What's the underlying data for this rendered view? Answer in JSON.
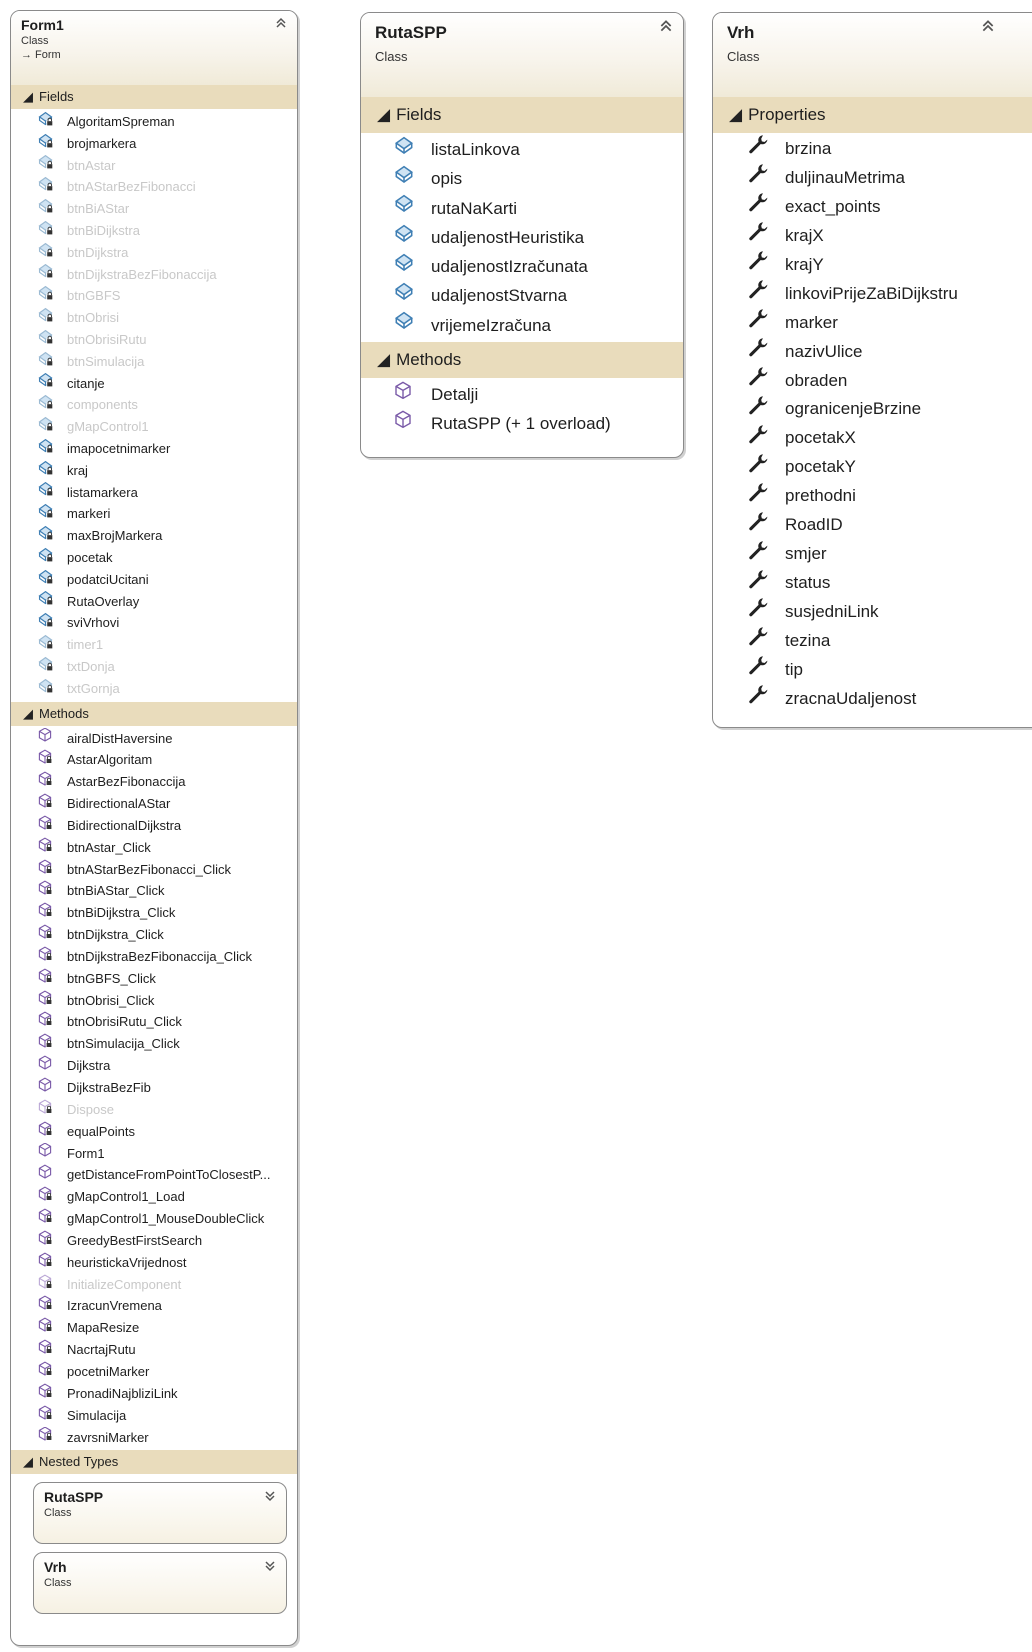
{
  "form1": {
    "title": "Form1",
    "stereotype": "Class",
    "base": "→ Form",
    "fields_label": "Fields",
    "fields": [
      {
        "name": "AlgoritamSpreman",
        "dim": false
      },
      {
        "name": "brojmarkera",
        "dim": false
      },
      {
        "name": "btnAstar",
        "dim": true
      },
      {
        "name": "btnAStarBezFibonacci",
        "dim": true
      },
      {
        "name": "btnBiAStar",
        "dim": true
      },
      {
        "name": "btnBiDijkstra",
        "dim": true
      },
      {
        "name": "btnDijkstra",
        "dim": true
      },
      {
        "name": "btnDijkstraBezFibonaccija",
        "dim": true
      },
      {
        "name": "btnGBFS",
        "dim": true
      },
      {
        "name": "btnObrisi",
        "dim": true
      },
      {
        "name": "btnObrisiRutu",
        "dim": true
      },
      {
        "name": "btnSimulacija",
        "dim": true
      },
      {
        "name": "citanje",
        "dim": false
      },
      {
        "name": "components",
        "dim": true
      },
      {
        "name": "gMapControl1",
        "dim": true
      },
      {
        "name": "imapocetnimarker",
        "dim": false
      },
      {
        "name": "kraj",
        "dim": false
      },
      {
        "name": "listamarkera",
        "dim": false
      },
      {
        "name": "markeri",
        "dim": false
      },
      {
        "name": "maxBrojMarkera",
        "dim": false
      },
      {
        "name": "pocetak",
        "dim": false
      },
      {
        "name": "podatciUcitani",
        "dim": false
      },
      {
        "name": "RutaOverlay",
        "dim": false
      },
      {
        "name": "sviVrhovi",
        "dim": false
      },
      {
        "name": "timer1",
        "dim": true
      },
      {
        "name": "txtDonja",
        "dim": true
      },
      {
        "name": "txtGornja",
        "dim": true
      }
    ],
    "methods_label": "Methods",
    "methods": [
      {
        "name": "airalDistHaversine",
        "dim": false,
        "public": true
      },
      {
        "name": "AstarAlgoritam",
        "dim": false,
        "public": false
      },
      {
        "name": "AstarBezFibonaccija",
        "dim": false,
        "public": false
      },
      {
        "name": "BidirectionalAStar",
        "dim": false,
        "public": false
      },
      {
        "name": "BidirectionalDijkstra",
        "dim": false,
        "public": false
      },
      {
        "name": "btnAstar_Click",
        "dim": false,
        "public": false
      },
      {
        "name": "btnAStarBezFibonacci_Click",
        "dim": false,
        "public": false
      },
      {
        "name": "btnBiAStar_Click",
        "dim": false,
        "public": false
      },
      {
        "name": "btnBiDijkstra_Click",
        "dim": false,
        "public": false
      },
      {
        "name": "btnDijkstra_Click",
        "dim": false,
        "public": false
      },
      {
        "name": "btnDijkstraBezFibonaccija_Click",
        "dim": false,
        "public": false
      },
      {
        "name": "btnGBFS_Click",
        "dim": false,
        "public": false
      },
      {
        "name": "btnObrisi_Click",
        "dim": false,
        "public": false
      },
      {
        "name": "btnObrisiRutu_Click",
        "dim": false,
        "public": false
      },
      {
        "name": "btnSimulacija_Click",
        "dim": false,
        "public": false
      },
      {
        "name": "Dijkstra",
        "dim": false,
        "public": true
      },
      {
        "name": "DijkstraBezFib",
        "dim": false,
        "public": true
      },
      {
        "name": "Dispose",
        "dim": true,
        "public": false
      },
      {
        "name": "equalPoints",
        "dim": false,
        "public": false
      },
      {
        "name": "Form1",
        "dim": false,
        "public": true
      },
      {
        "name": "getDistanceFromPointToClosestP...",
        "dim": false,
        "public": true
      },
      {
        "name": "gMapControl1_Load",
        "dim": false,
        "public": false
      },
      {
        "name": "gMapControl1_MouseDoubleClick",
        "dim": false,
        "public": false
      },
      {
        "name": "GreedyBestFirstSearch",
        "dim": false,
        "public": false
      },
      {
        "name": "heuristickaVrijednost",
        "dim": false,
        "public": false
      },
      {
        "name": "InitializeComponent",
        "dim": true,
        "public": false
      },
      {
        "name": "IzracunVremena",
        "dim": false,
        "public": false
      },
      {
        "name": "MapaResize",
        "dim": false,
        "public": false
      },
      {
        "name": "NacrtajRutu",
        "dim": false,
        "public": false
      },
      {
        "name": "pocetniMarker",
        "dim": false,
        "public": false
      },
      {
        "name": "PronadiNajbliziLink",
        "dim": false,
        "public": false
      },
      {
        "name": "Simulacija",
        "dim": false,
        "public": false
      },
      {
        "name": "zavrsniMarker",
        "dim": false,
        "public": false
      }
    ],
    "nested_label": "Nested Types",
    "nested": [
      {
        "title": "RutaSPP",
        "stereotype": "Class"
      },
      {
        "title": "Vrh",
        "stereotype": "Class"
      }
    ]
  },
  "rutaspp": {
    "title": "RutaSPP",
    "stereotype": "Class",
    "fields_label": "Fields",
    "fields": [
      "listaLinkova",
      "opis",
      "rutaNaKarti",
      "udaljenostHeuristika",
      "udaljenostIzračunata",
      "udaljenostStvarna",
      "vrijemeIzračuna"
    ],
    "methods_label": "Methods",
    "methods": [
      "Detalji",
      "RutaSPP (+ 1 overload)"
    ]
  },
  "vrh": {
    "title": "Vrh",
    "stereotype": "Class",
    "properties_label": "Properties",
    "properties": [
      "brzina",
      "duljinauMetrima",
      "exact_points",
      "krajX",
      "krajY",
      "linkoviPrijeZaBiDijkstru",
      "marker",
      "nazivUlice",
      "obraden",
      "ogranicenjeBrzine",
      "pocetakX",
      "pocetakY",
      "prethodni",
      "RoadID",
      "smjer",
      "status",
      "susjedniLink",
      "tezina",
      "tip",
      "zracnaUdaljenost"
    ]
  },
  "colors": {
    "section_bg": "#e9dcbc",
    "field_icon": "#3f7fb4",
    "method_icon": "#7a5aa8",
    "property_icon": "#222222",
    "dim_text": "#c8c8c8"
  },
  "icons": {
    "collapse": "double-chevron-up-icon",
    "expand": "double-chevron-down-icon",
    "field": "field-icon",
    "private_field": "private-field-icon",
    "method": "method-icon",
    "private_method": "private-method-icon",
    "property": "wrench-property-icon"
  }
}
